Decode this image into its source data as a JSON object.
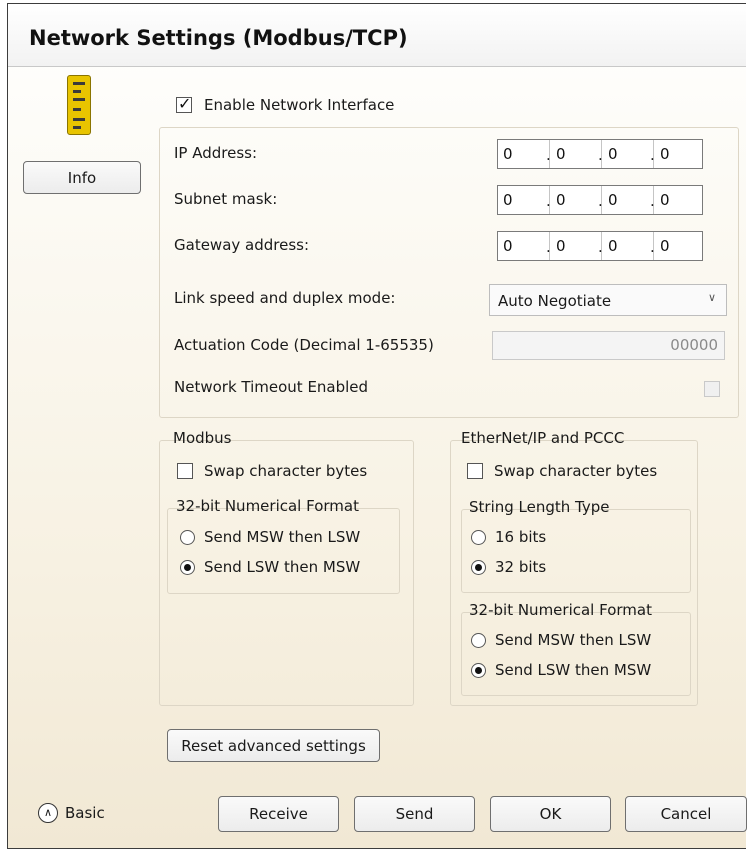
{
  "dialog": {
    "title": "Network Settings  (Modbus/TCP)",
    "device_icon": "device-module-icon"
  },
  "sidebar": {
    "info_button": "Info",
    "basic_toggle": {
      "label": "Basic",
      "icon": "chevron-up-circle-icon"
    }
  },
  "network": {
    "enable_checkbox": {
      "label": "Enable Network Interface",
      "checked": true
    },
    "ip_address": {
      "label": "IP Address:",
      "octets": [
        "0",
        "0",
        "0",
        "0"
      ]
    },
    "subnet_mask": {
      "label": "Subnet mask:",
      "octets": [
        "0",
        "0",
        "0",
        "0"
      ]
    },
    "gateway_address": {
      "label": "Gateway address:",
      "octets": [
        "0",
        "0",
        "0",
        "0"
      ]
    },
    "link_speed": {
      "label": "Link speed and duplex mode:",
      "value": "Auto Negotiate",
      "dropdown_icon": "chevron-down-icon"
    },
    "actuation_code": {
      "label": "Actuation Code (Decimal 1-65535)",
      "value": "00000"
    },
    "network_timeout": {
      "label": "Network Timeout Enabled",
      "checked": false
    }
  },
  "modbus": {
    "group_label": "Modbus",
    "swap_bytes": {
      "label": "Swap character bytes",
      "checked": false
    },
    "numerical_format": {
      "group_label": "32-bit Numerical Format",
      "options": [
        "Send MSW then LSW",
        "Send LSW then MSW"
      ],
      "selected": "Send LSW then MSW"
    }
  },
  "ethernet_ip": {
    "group_label": "EtherNet/IP and PCCC",
    "swap_bytes": {
      "label": "Swap character bytes",
      "checked": false
    },
    "string_length_type": {
      "group_label": "String Length Type",
      "options": [
        "16 bits",
        "32 bits"
      ],
      "selected": "32 bits"
    },
    "numerical_format": {
      "group_label": "32-bit Numerical Format",
      "options": [
        "Send MSW then LSW",
        "Send LSW then MSW"
      ],
      "selected": "Send LSW then MSW"
    }
  },
  "actions": {
    "reset_advanced": "Reset advanced settings",
    "receive": "Receive",
    "send": "Send",
    "ok": "OK",
    "cancel": "Cancel"
  },
  "colors": {
    "device_yellow": "#e8c400",
    "background_gradient_bottom": "#f1e8d4",
    "group_border": "#ddd6c6"
  }
}
